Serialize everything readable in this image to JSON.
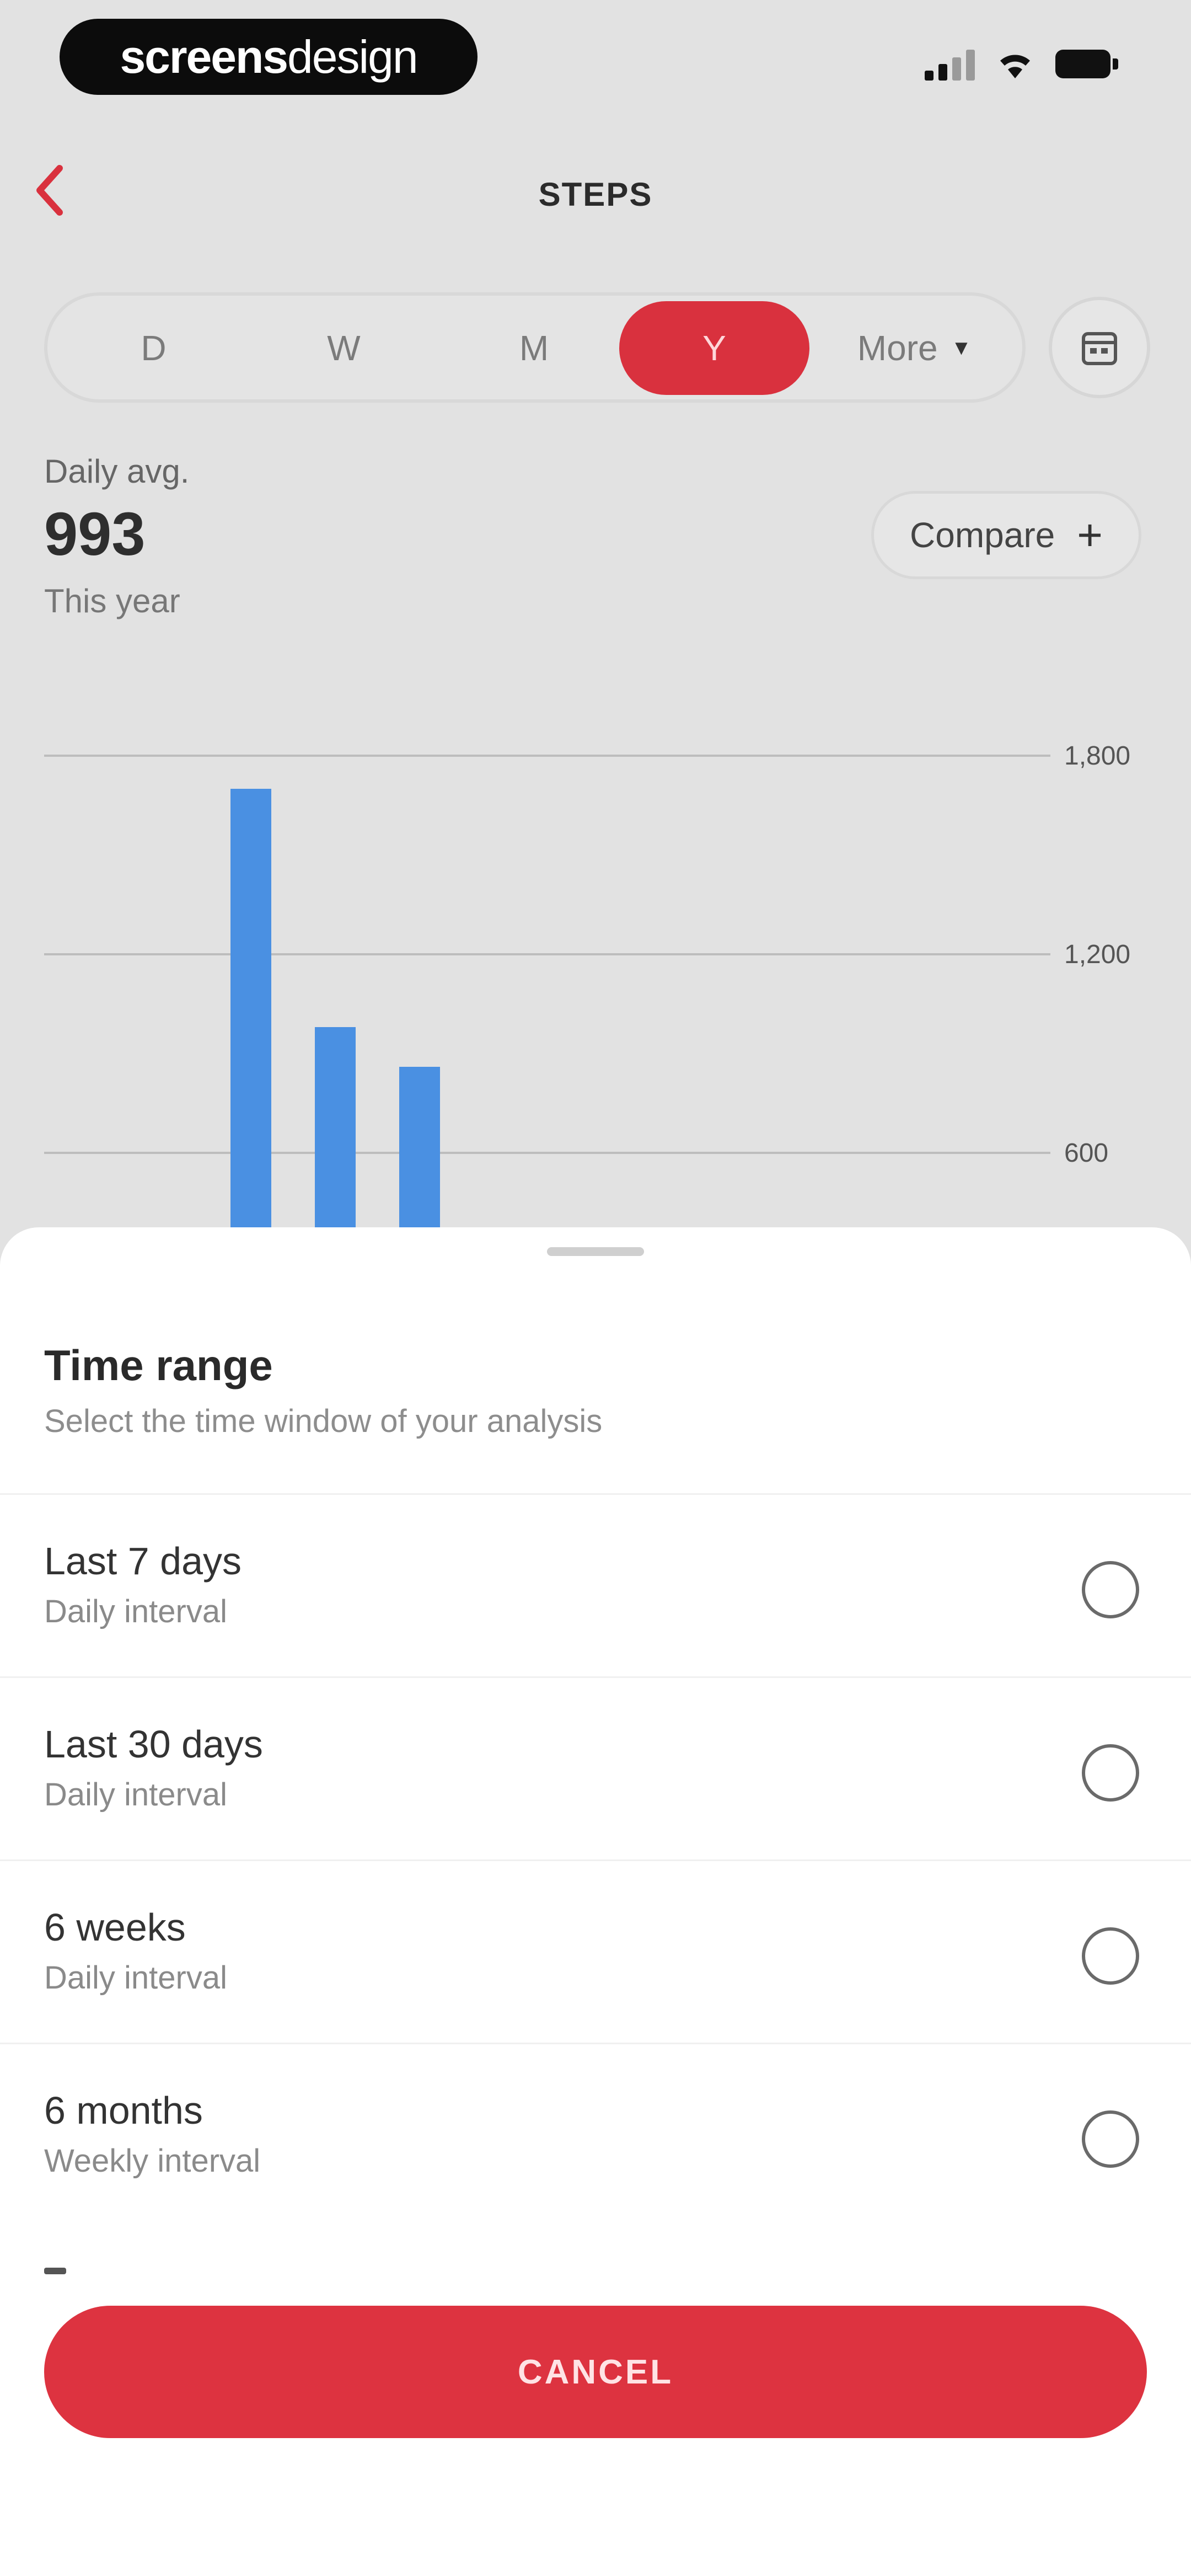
{
  "status_bar": {
    "brand_part1": "screens",
    "brand_part2": "design"
  },
  "header": {
    "title": "STEPS",
    "back_icon": "chevron-left-icon"
  },
  "period_tabs": [
    {
      "label": "D",
      "active": false
    },
    {
      "label": "W",
      "active": false
    },
    {
      "label": "M",
      "active": false
    },
    {
      "label": "Y",
      "active": true
    },
    {
      "label": "More",
      "active": false
    }
  ],
  "calendar_button_icon": "calendar-icon",
  "stats": {
    "label": "Daily avg.",
    "value": "993",
    "period": "This year"
  },
  "compare": {
    "label": "Compare",
    "icon": "plus-icon"
  },
  "chart_data": {
    "type": "bar",
    "y_ticks": [
      "1,800",
      "1,200",
      "600"
    ],
    "ylim": [
      0,
      1800
    ],
    "values": [
      1700,
      980,
      860
    ],
    "color": "#4a90e2",
    "grid": true
  },
  "sheet": {
    "title": "Time range",
    "subtitle": "Select the time window of your analysis",
    "options": [
      {
        "label": "Last 7 days",
        "sub": "Daily interval",
        "selected": false
      },
      {
        "label": "Last 30 days",
        "sub": "Daily interval",
        "selected": false
      },
      {
        "label": "6 weeks",
        "sub": "Daily interval",
        "selected": false
      },
      {
        "label": "6 months",
        "sub": "Weekly interval",
        "selected": false
      }
    ],
    "cancel_label": "CANCEL"
  },
  "colors": {
    "accent": "#d9313e",
    "bar": "#4a90e2"
  }
}
